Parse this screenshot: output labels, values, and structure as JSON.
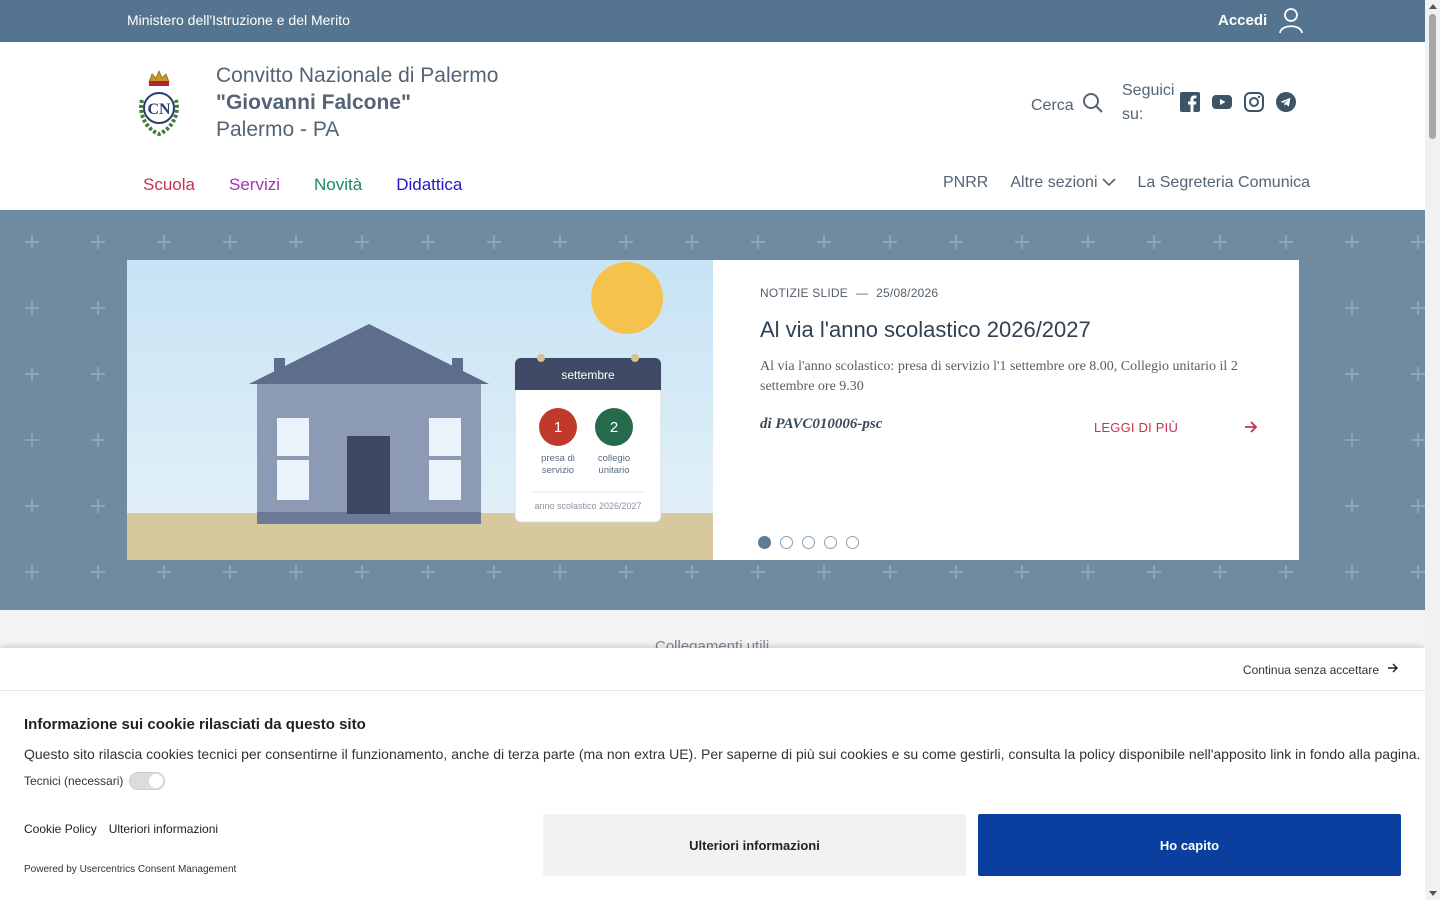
{
  "topbar": {
    "ministry": "Ministero dell'Istruzione e del Merito",
    "login": "Accedi"
  },
  "header": {
    "line1": "Convitto Nazionale di Palermo",
    "line2": "\"Giovanni Falcone\"",
    "line3": "Palermo - PA",
    "search": "Cerca",
    "follow": "Seguici su:",
    "socials": [
      "facebook-icon",
      "youtube-icon",
      "instagram-icon",
      "telegram-icon"
    ]
  },
  "mainnav": [
    {
      "label": "Scuola",
      "color": "#c2334d"
    },
    {
      "label": "Servizi",
      "color": "#a036b0"
    },
    {
      "label": "Novità",
      "color": "#1b8a5a"
    },
    {
      "label": "Didattica",
      "color": "#2417c9"
    }
  ],
  "secnav": {
    "pnrr": "PNRR",
    "other": "Altre sezioni",
    "segreteria": "La Segreteria Comunica"
  },
  "slide": {
    "category": "NOTIZIE SLIDE",
    "date": "25/08/2026",
    "title": "Al via l'anno scolastico 2026/2027",
    "text": "Al via l'anno scolastico: presa di servizio l'1 settembre ore 8.00, Collegio unitario il 2 settembre ore 9.30",
    "author": "di PAVC010006-psc",
    "readmore": "LEGGI DI PIÙ",
    "total_slides": 5,
    "active_slide": 1,
    "image": {
      "calendar_month": "settembre",
      "day1": "1",
      "day1_label": "presa di servizio",
      "day2": "2",
      "day2_label": "collegio unitario",
      "footer": "anno scolastico 2026/2027"
    }
  },
  "links_strip": {
    "title": "Collegamenti utili"
  },
  "cookie": {
    "continue": "Continua senza accettare",
    "title": "Informazione sui cookie rilasciati da questo sito",
    "text": "Questo sito rilascia cookies tecnici per consentirne il funzionamento, anche di terza parte (ma non extra UE). Per saperne di più sui cookies e su come gestirli, consulta la policy disponibile nell'apposito link in fondo alla pagina.",
    "toggle_label": "Tecnici (necessari)",
    "link_policy": "Cookie Policy",
    "link_more": "Ulteriori informazioni",
    "powered": "Powered by Usercentrics Consent Management",
    "btn_more": "Ulteriori informazioni",
    "btn_ok": "Ho capito"
  },
  "colors": {
    "topbar": "#55748f",
    "hero": "#6f8ba1",
    "accent_red": "#c2334d",
    "primary_button": "#0a3f9f"
  }
}
